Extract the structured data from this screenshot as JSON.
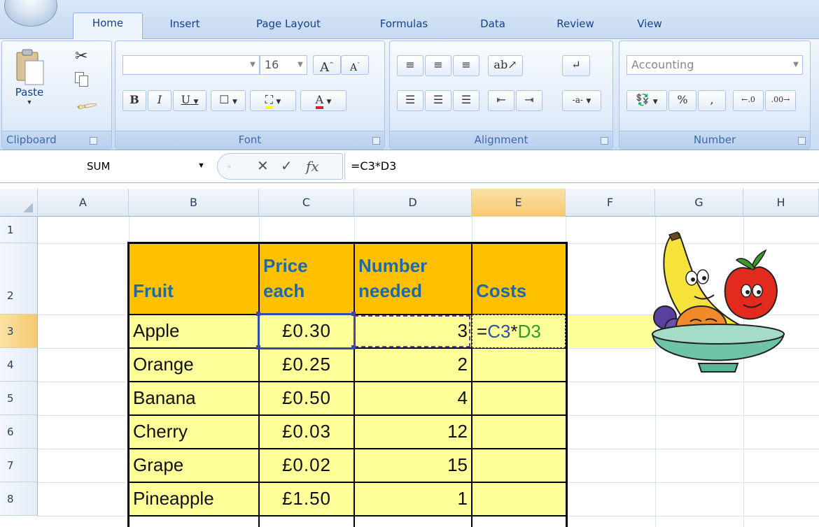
{
  "ribbon": {
    "tabs": [
      {
        "label": "Home",
        "active": true
      },
      {
        "label": "Insert"
      },
      {
        "label": "Page Layout"
      },
      {
        "label": "Formulas"
      },
      {
        "label": "Data"
      },
      {
        "label": "Review"
      },
      {
        "label": "View"
      }
    ],
    "clipboard": {
      "label": "Clipboard",
      "paste": "Paste"
    },
    "font": {
      "label": "Font",
      "name": "",
      "size": "16"
    },
    "alignment": {
      "label": "Alignment"
    },
    "number": {
      "label": "Number",
      "format": "Accounting",
      "percent": "%",
      "comma": ","
    }
  },
  "formula_bar": {
    "name_box": "SUM",
    "formula": "=C3*D3"
  },
  "columns": [
    "A",
    "B",
    "C",
    "D",
    "E",
    "F",
    "G",
    "H"
  ],
  "rows": [
    "1",
    "2",
    "3",
    "4",
    "5",
    "6",
    "7",
    "8"
  ],
  "table": {
    "headers": {
      "fruit": "Fruit",
      "price_line1": "Price",
      "price_line2": "each",
      "number_line1": "Number",
      "number_line2": "needed",
      "costs": "Costs"
    },
    "rows": [
      {
        "fruit": "Apple",
        "price": "£0.30",
        "number": "3"
      },
      {
        "fruit": "Orange",
        "price": "£0.25",
        "number": "2"
      },
      {
        "fruit": "Banana",
        "price": "£0.50",
        "number": "4"
      },
      {
        "fruit": "Cherry",
        "price": "£0.03",
        "number": "12"
      },
      {
        "fruit": "Grape",
        "price": "£0.02",
        "number": "15"
      },
      {
        "fruit": "Pineapple",
        "price": "£1.50",
        "number": "1"
      }
    ],
    "editing_cell": {
      "eq": "=",
      "ref1": "C3",
      "op": "*",
      "ref2": "D3"
    }
  },
  "colors": {
    "header_fill": "#ffc000",
    "data_fill": "#ffff99",
    "header_text": "#1f6aa5",
    "ref1_color": "#2e4fae",
    "ref2_color": "#2e9a2e"
  },
  "icons": [
    "office-button",
    "cut-icon",
    "copy-icon",
    "format-painter-icon",
    "bold-icon",
    "italic-icon",
    "underline-icon",
    "border-icon",
    "fill-color-icon",
    "font-color-icon",
    "align-icon",
    "wrap-text-icon",
    "merge-icon",
    "currency-icon",
    "cancel-icon",
    "enter-icon",
    "function-icon"
  ]
}
